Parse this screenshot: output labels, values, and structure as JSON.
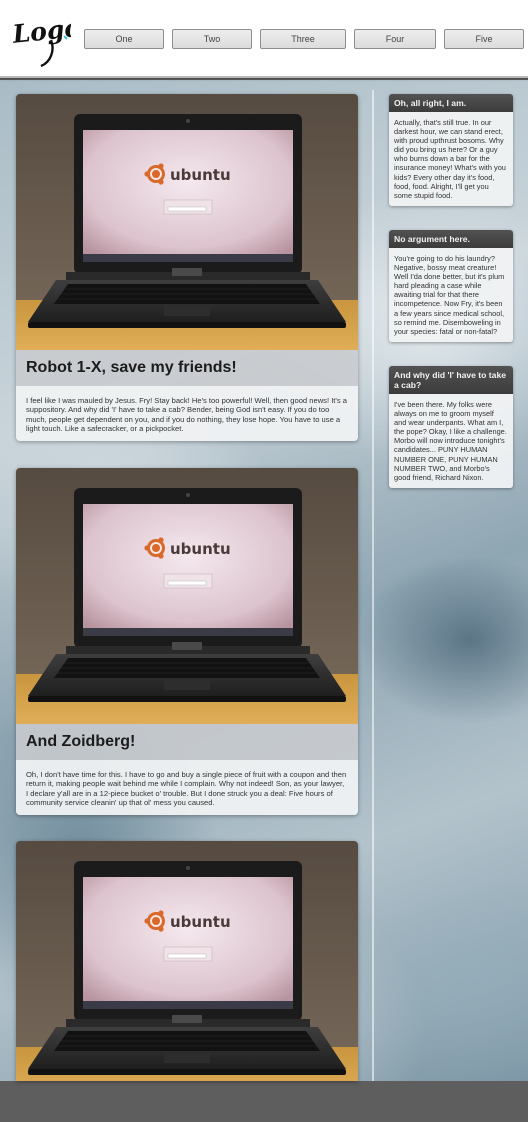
{
  "header": {
    "logo_text": "Logo",
    "nav": [
      {
        "label": "One"
      },
      {
        "label": "Two"
      },
      {
        "label": "Three"
      },
      {
        "label": "Four"
      },
      {
        "label": "Five"
      }
    ]
  },
  "articles": [
    {
      "image_icon": "laptop-image",
      "screen_text": "ubuntu",
      "title": "Robot 1-X, save my friends!",
      "body": "I feel like I was mauled by Jesus. Fry! Stay back! He's too powerful! Well, then good news! It's a suppository. And why did 'I' have to take a cab? Bender, being God isn't easy. If you do too much, people get dependent on you, and if you do nothing, they lose hope. You have to use a light touch. Like a safecracker, or a pickpocket."
    },
    {
      "image_icon": "laptop-image",
      "screen_text": "ubuntu",
      "title": "And Zoidberg!",
      "body": "Oh, I don't have time for this. I have to go and buy a single piece of fruit with a coupon and then return it, making people wait behind me while I complain. Why not indeed! Son, as your lawyer, I declare y'all are in a 12-piece bucket o' trouble. But I done struck you a deal: Five hours of community service cleanin' up that ol' mess you caused."
    },
    {
      "image_icon": "laptop-image",
      "screen_text": "ubuntu"
    }
  ],
  "sidebar": [
    {
      "title": "Oh, all right, I am.",
      "body": "Actually, that's still true. In our darkest hour, we can stand erect, with proud upthrust bosoms. Why did you bring us here? Or a guy who burns down a bar for the insurance money! What's with you kids? Every other day it's food, food, food. Alright, I'll get you some stupid food."
    },
    {
      "title": "No argument here.",
      "body": "You're going to do his laundry? Negative, bossy meat creature! Well I'da done better, but it's plum hard pleading a case while awaiting trial for that there incompetence. Now Fry, it's been a few years since medical school, so remind me. Disemboweling in your species: fatal or non-fatal?"
    },
    {
      "title": "And why did 'I' have to take a cab?",
      "body": "I've been there. My folks were always on me to groom myself and wear underpants. What am I, the pope? Okay, I like a challenge. Morbo will now introduce tonight's candidates... PUNY HUMAN NUMBER ONE, PUNY HUMAN NUMBER TWO, and Morbo's good friend, Richard Nixon."
    }
  ]
}
